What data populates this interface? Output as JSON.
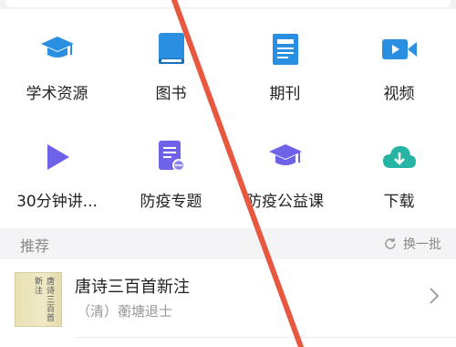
{
  "grid": {
    "items": [
      {
        "label": "学术资源",
        "icon": "graduation-cap-icon"
      },
      {
        "label": "图书",
        "icon": "book-icon"
      },
      {
        "label": "期刊",
        "icon": "journal-icon"
      },
      {
        "label": "视频",
        "icon": "video-camera-icon"
      },
      {
        "label": "30分钟讲...",
        "icon": "play-icon"
      },
      {
        "label": "防疫专题",
        "icon": "document-badge-icon"
      },
      {
        "label": "防疫公益课",
        "icon": "graduation-cap-icon"
      },
      {
        "label": "下载",
        "icon": "cloud-download-icon"
      }
    ]
  },
  "recommend": {
    "title": "推荐",
    "refresh_label": "换一批"
  },
  "book": {
    "title": "唐诗三百首新注",
    "author": "（清）蘅塘退士",
    "cover_text": "唐诗三百首新注"
  },
  "colors": {
    "primary_blue": "#2a8fe0",
    "purple": "#6e62e8",
    "teal": "#26b5a4",
    "annotation_red": "#e8573f",
    "section_bg": "#f4f4f6"
  }
}
